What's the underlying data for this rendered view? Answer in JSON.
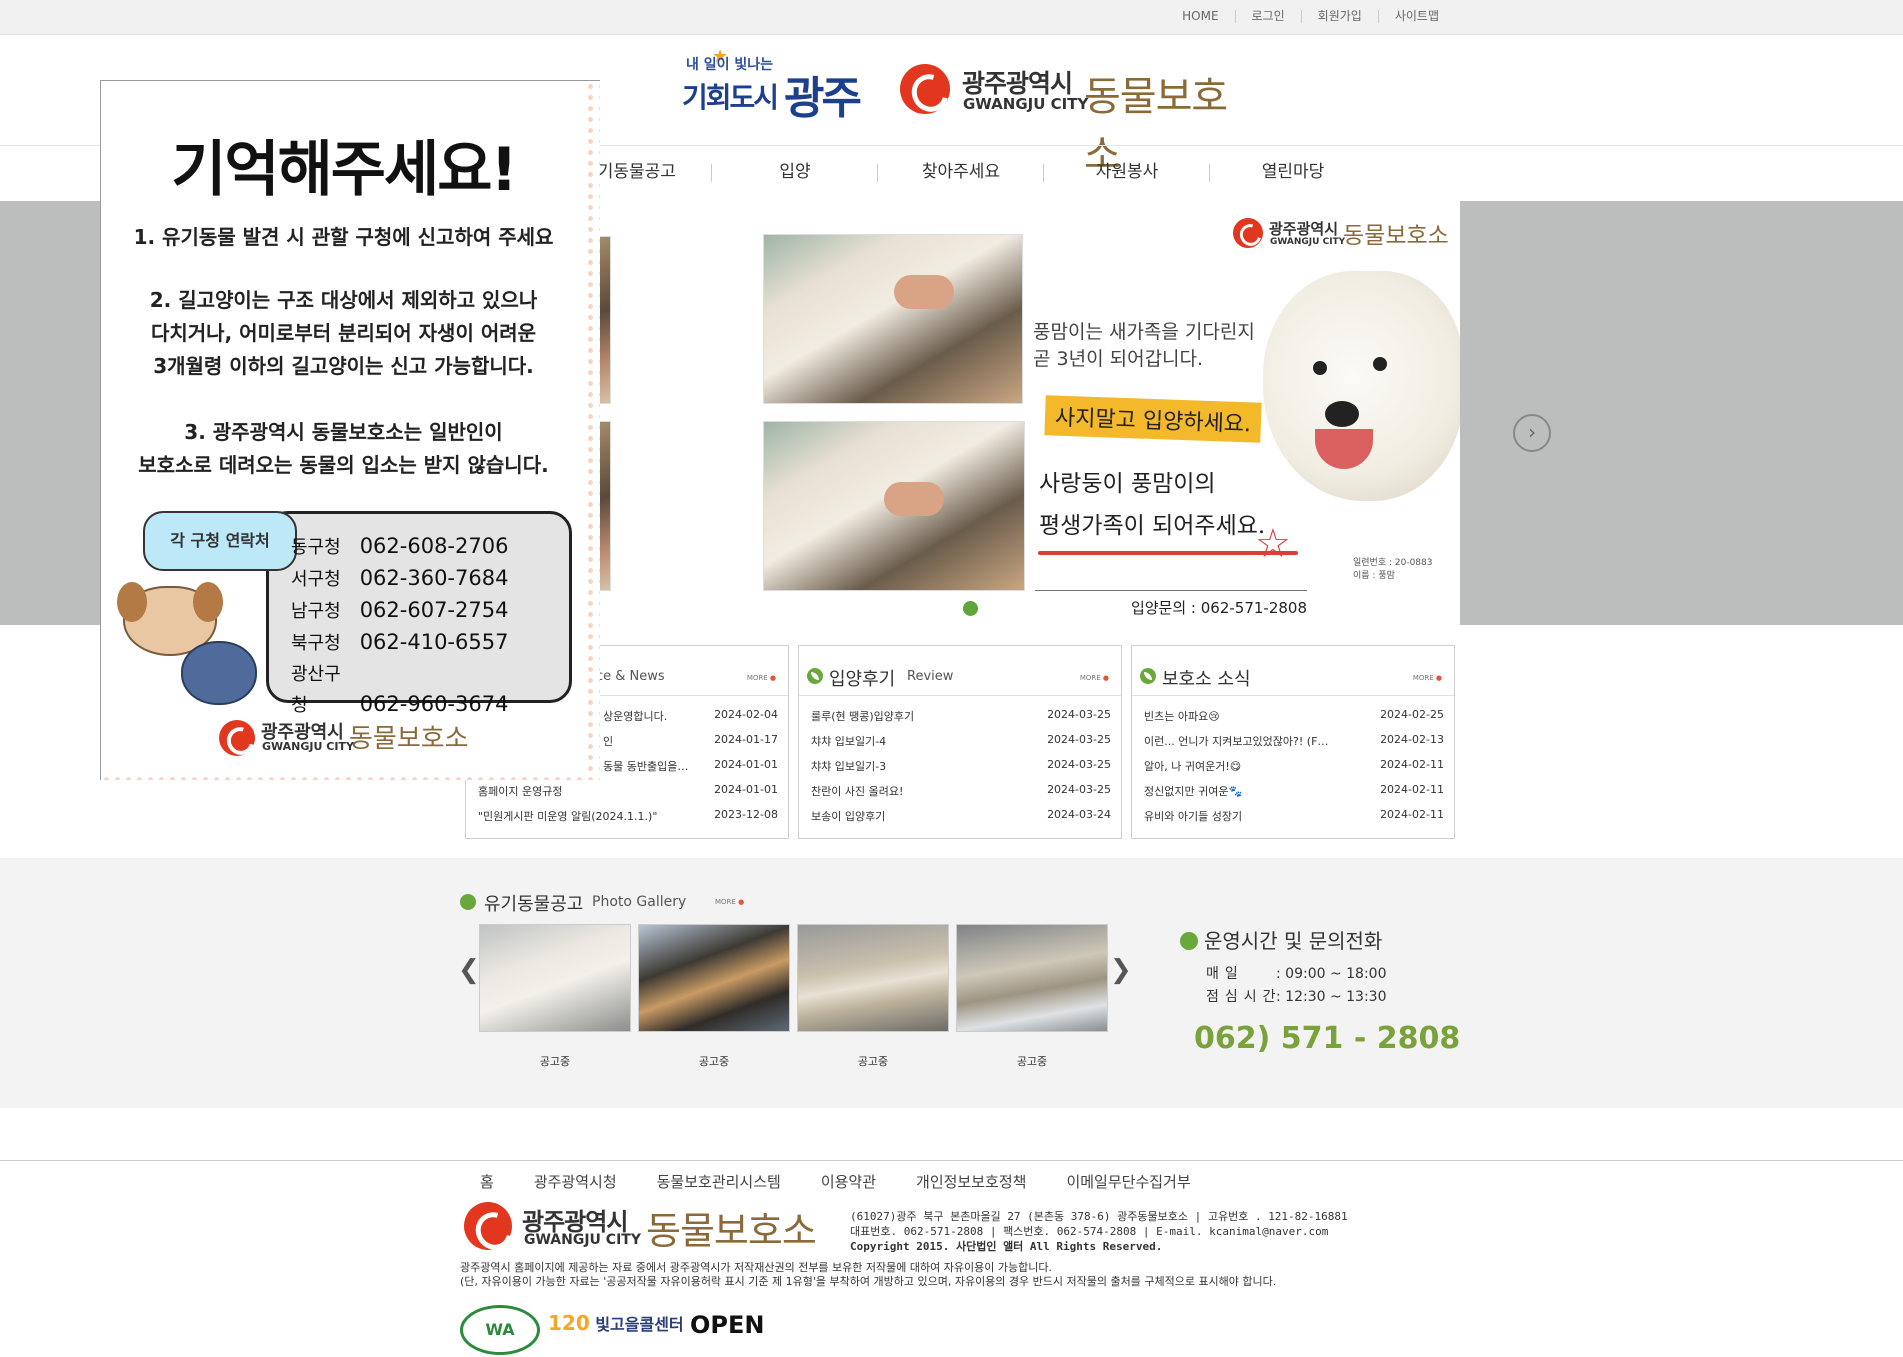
{
  "util": [
    "HOME",
    "로그인",
    "회원가입",
    "사이트맵"
  ],
  "header": {
    "logo1_small": "내 일이 빛나는",
    "logo1_big1": "기회도시",
    "logo1_big2": "광주",
    "logo2_city": "광주광역시",
    "logo2_eng": "GWANGJU CITY",
    "logo2_shelter": "동물보호소"
  },
  "nav": [
    "유기동물공고",
    "입양",
    "찾아주세요",
    "자원봉사",
    "열린마당"
  ],
  "slide": {
    "logo_city": "광주광역시",
    "logo_eng": "GWANGJU CITY",
    "logo_shelter": "동물보호소",
    "text1": "풍맘이는 새가족을 기다린지\n곧 3년이 되어갑니다.",
    "highlight": "사지말고 입양하세요.",
    "text2": "사랑둥이 풍맘이의\n평생가족이 되어주세요.",
    "small": "일련번호 : 20-0883\n이름 : 풍맘",
    "contact": "입양문의 : 062-571-2808"
  },
  "popup": {
    "title": "기억해주세요!",
    "p1": "1. 유기동물 발견 시 관할 구청에 신고하여 주세요",
    "p2": "2. 길고양이는 구조 대상에서 제외하고 있으나\n다치거나, 어미로부터 분리되어 자생이 어려운\n3개월령 이하의 길고양이는 신고 가능합니다.",
    "p3": "3. 광주광역시 동물보호소는 일반인이\n보호소로 데려오는 동물의 입소는 받지 않습니다.",
    "tag": "각 구청 연락처",
    "contacts": [
      {
        "name": "동구청",
        "tel": "062-608-2706"
      },
      {
        "name": "서구청",
        "tel": "062-360-7684"
      },
      {
        "name": "남구청",
        "tel": "062-607-2754"
      },
      {
        "name": "북구청",
        "tel": "062-410-6557"
      },
      {
        "name": "광산구청",
        "tel": "062-960-3674"
      }
    ],
    "logo_city": "광주광역시",
    "logo_eng": "GWANGJU CITY",
    "logo_shelter": "동물보호소"
  },
  "boards": [
    {
      "title": "",
      "subtitle": "ce & News",
      "more": "MORE",
      "items": [
        {
          "title": "상운영합니다.",
          "date": "2024-02-04"
        },
        {
          "title": "인",
          "date": "2024-01-17"
        },
        {
          "title": "동물 동반출입을…",
          "date": "2024-01-01"
        },
        {
          "title": "홈페이지 운영규정",
          "date": "2024-01-01"
        },
        {
          "title": "\"민원게시판 미운영 알림(2024.1.1.)\"",
          "date": "2023-12-08"
        }
      ]
    },
    {
      "title": "입양후기",
      "subtitle": "Review",
      "more": "MORE",
      "items": [
        {
          "title": "룰루(현 땡콩)입양후기",
          "date": "2024-03-25"
        },
        {
          "title": "챠챠 입보일기-4",
          "date": "2024-03-25"
        },
        {
          "title": "챠챠 입보일기-3",
          "date": "2024-03-25"
        },
        {
          "title": "찬란이 사진 올려요!",
          "date": "2024-03-25"
        },
        {
          "title": "보송이 입양후기",
          "date": "2024-03-24"
        }
      ]
    },
    {
      "title": "보호소 소식",
      "subtitle": "",
      "more": "MORE",
      "items": [
        {
          "title": "빈츠는 아파요😢",
          "date": "2024-02-25"
        },
        {
          "title": "이런... 언니가 지켜보고있었잖아?! (F…",
          "date": "2024-02-13"
        },
        {
          "title": "알아, 나 귀여운거!😋",
          "date": "2024-02-11"
        },
        {
          "title": "정신없지만 귀여운🐾",
          "date": "2024-02-11"
        },
        {
          "title": "유비와 아기들 성장기",
          "date": "2024-02-11"
        }
      ]
    }
  ],
  "gallery": {
    "title": "유기동물공고",
    "subtitle": "Photo Gallery",
    "more": "MORE",
    "prev": "❮",
    "next": "❯",
    "captions": [
      "공고중",
      "공고중",
      "공고중",
      "공고중"
    ]
  },
  "hours": {
    "title": "운영시간 및 문의전화",
    "rows": [
      {
        "label": "매일",
        "value": ": 09:00 ~ 18:00"
      },
      {
        "label": "점심시간",
        "value": ": 12:30 ~ 13:30"
      }
    ],
    "tel": "062) 571 - 2808"
  },
  "footer": {
    "menu": [
      "홈",
      "광주광역시청",
      "동물보호관리시스템",
      "이용약관",
      "개인정보보호정책",
      "이메일무단수집거부"
    ],
    "logo_city": "광주광역시",
    "logo_eng": "GWANGJU CITY",
    "logo_shelter": "동물보호소",
    "addr1": "(61027)광주 북구 본촌마을길 27 (본촌동 378-6) 광주동물보호소 | 고유번호 . 121-82-16881",
    "addr2": "대표번호. 062-571-2808 | 팩스번호. 062-574-2808 | E-mail. kcanimal@naver.com",
    "copyright": "Copyright 2015. 사단법인 앨터 All Rights Reserved.",
    "note1": "광주광역시 홈페이지에 제공하는 자료 중에서 광주광역시가 저작재산권의 전부를 보유한 저작물에 대하여 자유이용이 가능합니다.",
    "note2": "(단, 자유이용이 가능한 자료는 '공공저작물 자유이용허락 표시 기준 제 1유형'을 부착하여 개방하고 있으며, 자유이용의 경우 반드시 저작물의 출처를 구체적으로 표시해야 합니다.",
    "badge_wa": "WA",
    "badge_call": "빛고을콜센터",
    "badge_call_num": "120",
    "badge_open": "OPEN"
  },
  "colors": {
    "accent_green": "#6aa83c",
    "brand_red": "#e3361f",
    "shelter_brown": "#8b6a3a",
    "tel_green": "#7aa23a"
  }
}
